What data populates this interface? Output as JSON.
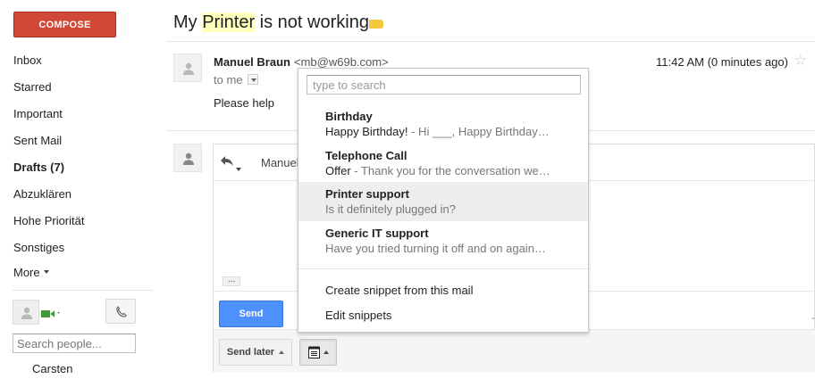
{
  "sidebar": {
    "compose_label": "COMPOSE",
    "items": [
      {
        "label": "Inbox"
      },
      {
        "label": "Starred"
      },
      {
        "label": "Important"
      },
      {
        "label": "Sent Mail"
      },
      {
        "label": "Drafts (7)"
      },
      {
        "label": "Abzuklären"
      },
      {
        "label": "Hohe Priorität"
      },
      {
        "label": "Sonstiges"
      }
    ],
    "more_label": "More",
    "search_people_placeholder": "Search people...",
    "contacts": [
      "Carsten"
    ]
  },
  "thread": {
    "subject_prefix": "My ",
    "subject_highlight": "Printer",
    "subject_suffix": " is not working"
  },
  "message": {
    "sender_name": "Manuel Braun",
    "sender_email": "<mb@w69b.com>",
    "to_label": "to me",
    "time": "11:42 AM (0 minutes ago)",
    "body": "Please help"
  },
  "reply": {
    "recipient": "Manuel",
    "send_label": "Send",
    "send_later_label": "Send later",
    "more_dots": "..."
  },
  "snippet_menu": {
    "search_placeholder": "type to search",
    "snippets": [
      {
        "title": "Birthday",
        "preview_dark": "Happy Birthday!",
        "preview_gray": " - Hi ___, Happy Birthday…",
        "active": false
      },
      {
        "title": "Telephone Call",
        "preview_dark": "Offer",
        "preview_gray": " - Thank you for the conversation we…",
        "active": false
      },
      {
        "title": "Printer support",
        "preview_dark": "",
        "preview_gray": "Is it definitely plugged in?",
        "active": true
      },
      {
        "title": "Generic IT support",
        "preview_dark": "",
        "preview_gray": "Have you tried turning it off and on again…",
        "active": false
      }
    ],
    "create_label": "Create snippet from this mail",
    "edit_label": "Edit snippets"
  },
  "colors": {
    "compose_red": "#d14836",
    "send_blue": "#4d90fe",
    "label_yellow": "#f2c83e",
    "highlight": "#ffffc0"
  }
}
